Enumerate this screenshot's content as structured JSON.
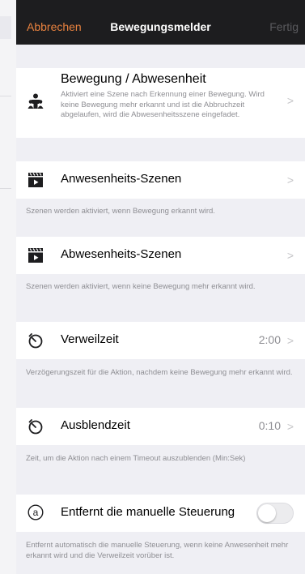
{
  "nav": {
    "cancel": "Abbrechen",
    "title": "Bewegungsmelder",
    "done": "Fertig"
  },
  "motion": {
    "title": "Bewegung / Abwesenheit",
    "description": "Aktiviert eine Szene nach Erkennung einer Bewegung. Wird keine Bewegung mehr erkannt und ist die Abbruchzeit abgelaufen, wird die Abwesenheitsszene eingefadet.",
    "chevron": ">"
  },
  "presence": {
    "title": "Anwesenheits-Szenen",
    "chevron": ">",
    "footer": "Szenen werden aktiviert, wenn Bewegung erkannt wird."
  },
  "absence": {
    "title": "Abwesenheits-Szenen",
    "chevron": ">",
    "footer": "Szenen werden aktiviert, wenn keine Bewegung mehr erkannt wird."
  },
  "dwell": {
    "title": "Verweilzeit",
    "value": "2:00",
    "chevron": ">",
    "footer": "Verzögerungszeit für die Aktion, nachdem keine Bewegung mehr erkannt wird."
  },
  "fadeout": {
    "title": "Ausblendzeit",
    "value": "0:10",
    "chevron": ">",
    "footer": "Zeit, um die Aktion nach einem Timeout auszublenden (Min:Sek)"
  },
  "manual": {
    "icon_letter": "a",
    "title": "Entfernt die manuelle Steuerung",
    "toggle_on": false,
    "footer": "Entfernt automatisch die manuelle Steuerung, wenn keine Anwesenheit mehr erkannt wird und die Verweilzeit vorüber ist."
  },
  "colors": {
    "accent": "#e8823f",
    "navbar": "#1d1d1f",
    "background": "#efeff4"
  }
}
